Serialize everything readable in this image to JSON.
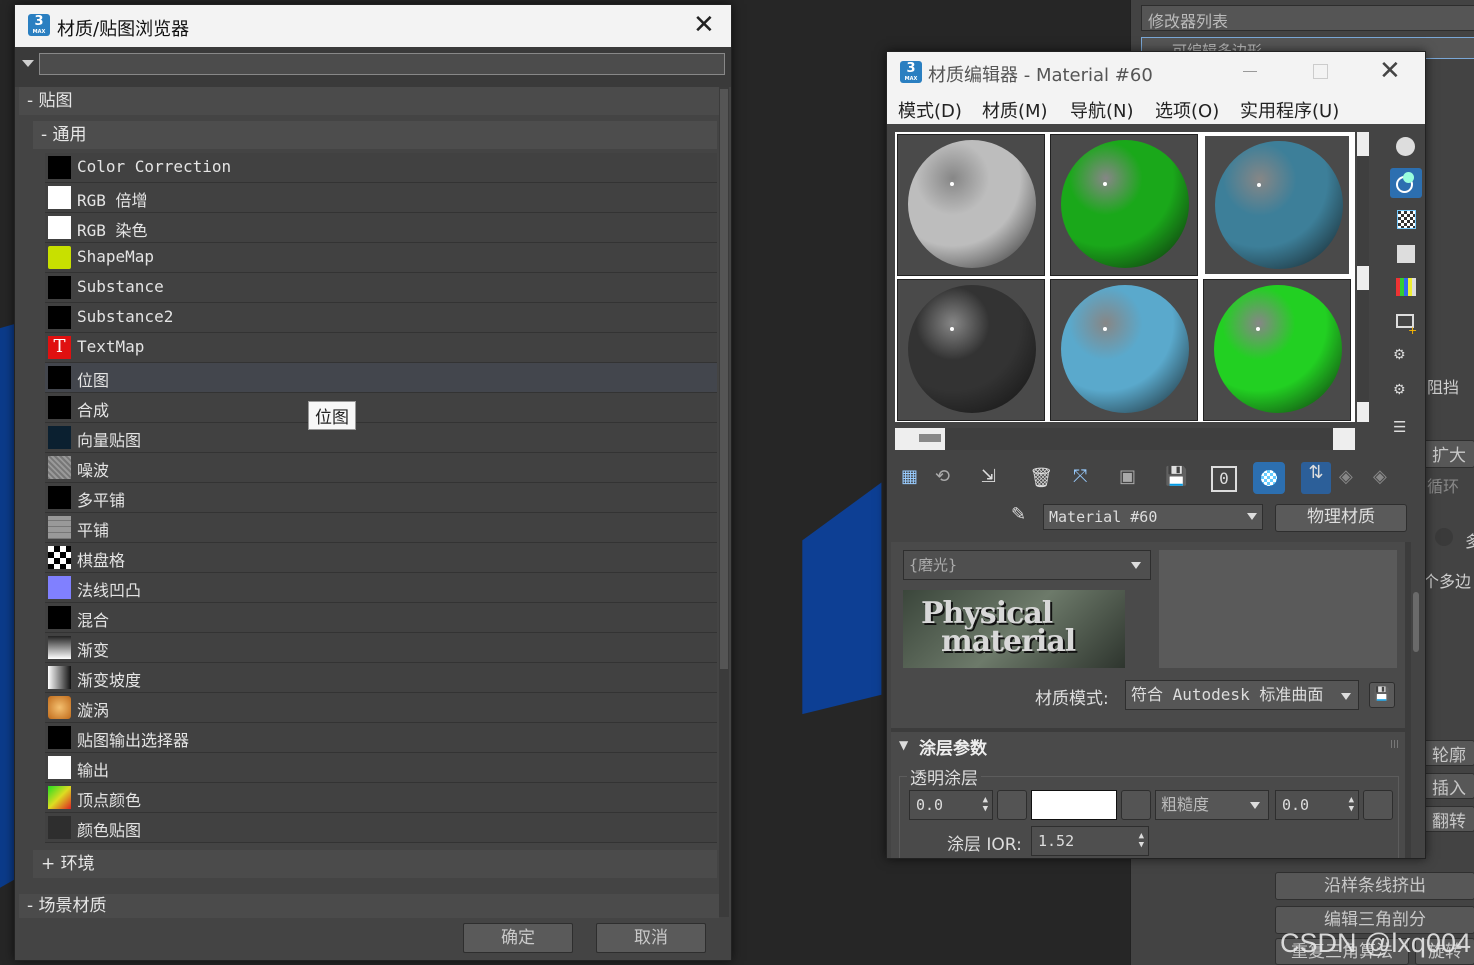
{
  "browser": {
    "title": "材质/贴图浏览器",
    "search_placeholder": "",
    "section_maps": "- 贴图",
    "subsection_general": "- 通用",
    "items": [
      {
        "label": "Color Correction",
        "icon": "black-swatch"
      },
      {
        "label": "RGB 倍增",
        "icon": "white-swatch"
      },
      {
        "label": "RGB 染色",
        "icon": "white-swatch"
      },
      {
        "label": "ShapeMap",
        "icon": "shapemap-spiral-icon"
      },
      {
        "label": "Substance",
        "icon": "black-swatch"
      },
      {
        "label": "Substance2",
        "icon": "black-swatch"
      },
      {
        "label": "TextMap",
        "icon": "text-T-icon"
      },
      {
        "label": "位图",
        "icon": "black-swatch"
      },
      {
        "label": "合成",
        "icon": "black-swatch"
      },
      {
        "label": "向量贴图",
        "icon": "vector-map-icon"
      },
      {
        "label": "噪波",
        "icon": "noise-icon"
      },
      {
        "label": "多平铺",
        "icon": "black-swatch"
      },
      {
        "label": "平铺",
        "icon": "tiles-icon"
      },
      {
        "label": "棋盘格",
        "icon": "checker-icon"
      },
      {
        "label": "法线凹凸",
        "icon": "normal-bump-icon"
      },
      {
        "label": "混合",
        "icon": "black-swatch"
      },
      {
        "label": "渐变",
        "icon": "gradient-icon"
      },
      {
        "label": "渐变坡度",
        "icon": "gradient-ramp-icon"
      },
      {
        "label": "漩涡",
        "icon": "swirl-icon"
      },
      {
        "label": "贴图输出选择器",
        "icon": "black-swatch"
      },
      {
        "label": "输出",
        "icon": "white-swatch"
      },
      {
        "label": "顶点颜色",
        "icon": "vertex-color-icon"
      },
      {
        "label": "颜色贴图",
        "icon": "color-map-icon"
      }
    ],
    "selected_index": 7,
    "tooltip": "位图",
    "subsection_environment": "+ 环境",
    "section_scene_materials": "- 场景材质",
    "ok_label": "确定",
    "cancel_label": "取消"
  },
  "editor": {
    "title": "材质编辑器 - Material #60",
    "menus": [
      "模式(D)",
      "材质(M)",
      "导航(N)",
      "选项(O)",
      "实用程序(U)"
    ],
    "material_name": "Material #60",
    "material_type": "物理材质",
    "preset": "{磨光}",
    "logo_line1": "Physical",
    "logo_line2": "material",
    "mode_label": "材质模式:",
    "mode_value": "符合 Autodesk 标准曲面",
    "rollout_title": "涂层参数",
    "group_label": "透明涂层",
    "coat_value": "0.0",
    "roughness_label": "粗糙度",
    "roughness_value": "0.0",
    "ior_label": "涂层 IOR:",
    "ior_value": "1.52",
    "zero_badge": "0",
    "slot_colors": [
      "#bdbdbd",
      "#1aa81a",
      "#3d7f99",
      "#333333",
      "#5aa9cc",
      "#22d022"
    ]
  },
  "command_panel": {
    "modifier_list": "修改器列表",
    "stack_item": "可编辑多边形",
    "label_block": "阻挡",
    "label_expand": "扩大",
    "label_loop": "循环",
    "label_many": "多",
    "label_polygon": "个多边",
    "label_outline": "轮廓",
    "label_insert": "插入",
    "label_flip": "翻转",
    "btn_extrude_spline": "沿样条线挤出",
    "btn_edit_tri": "编辑三角剖分",
    "btn_retriangulate": "重复三角算法",
    "btn_rotate": "旋转",
    "watermark": "CSDN @lxq004"
  }
}
